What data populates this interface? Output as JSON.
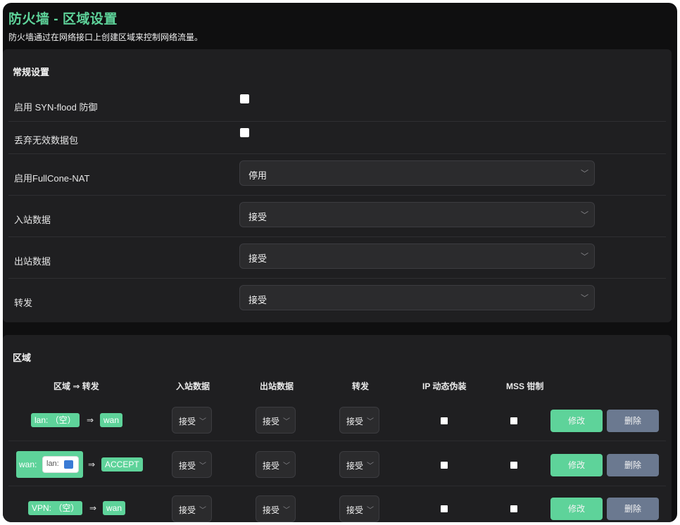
{
  "header": {
    "title": "防火墙 - 区域设置",
    "description": "防火墙通过在网络接口上创建区域来控制网络流量。"
  },
  "general": {
    "title": "常规设置",
    "syn_flood_label": "启用 SYN-flood 防御",
    "drop_invalid_label": "丢弃无效数据包",
    "fullcone_label": "启用FullCone-NAT",
    "fullcone_value": "停用",
    "input_label": "入站数据",
    "input_value": "接受",
    "output_label": "出站数据",
    "output_value": "接受",
    "forward_label": "转发",
    "forward_value": "接受"
  },
  "zones": {
    "title": "区域",
    "headers": {
      "zone_forward": "区域 ⇒ 转发",
      "input": "入站数据",
      "output": "出站数据",
      "forward": "转发",
      "masq": "IP 动态伪装",
      "mss": "MSS 钳制"
    },
    "arrow": "⇒",
    "edit_label": "修改",
    "delete_label": "删除",
    "rows": [
      {
        "zone": "lan: （空）",
        "target": "wan",
        "input": "接受",
        "output": "接受",
        "forward": "接受"
      },
      {
        "zone": "wan:",
        "network": "lan:",
        "target": "ACCEPT",
        "input": "接受",
        "output": "接受",
        "forward": "接受"
      },
      {
        "zone": "VPN: （空）",
        "target": "wan",
        "input": "接受",
        "output": "接受",
        "forward": "接受"
      }
    ]
  },
  "icons": {
    "chevron": "chevron-down-icon",
    "network_icon": "network-icon"
  }
}
